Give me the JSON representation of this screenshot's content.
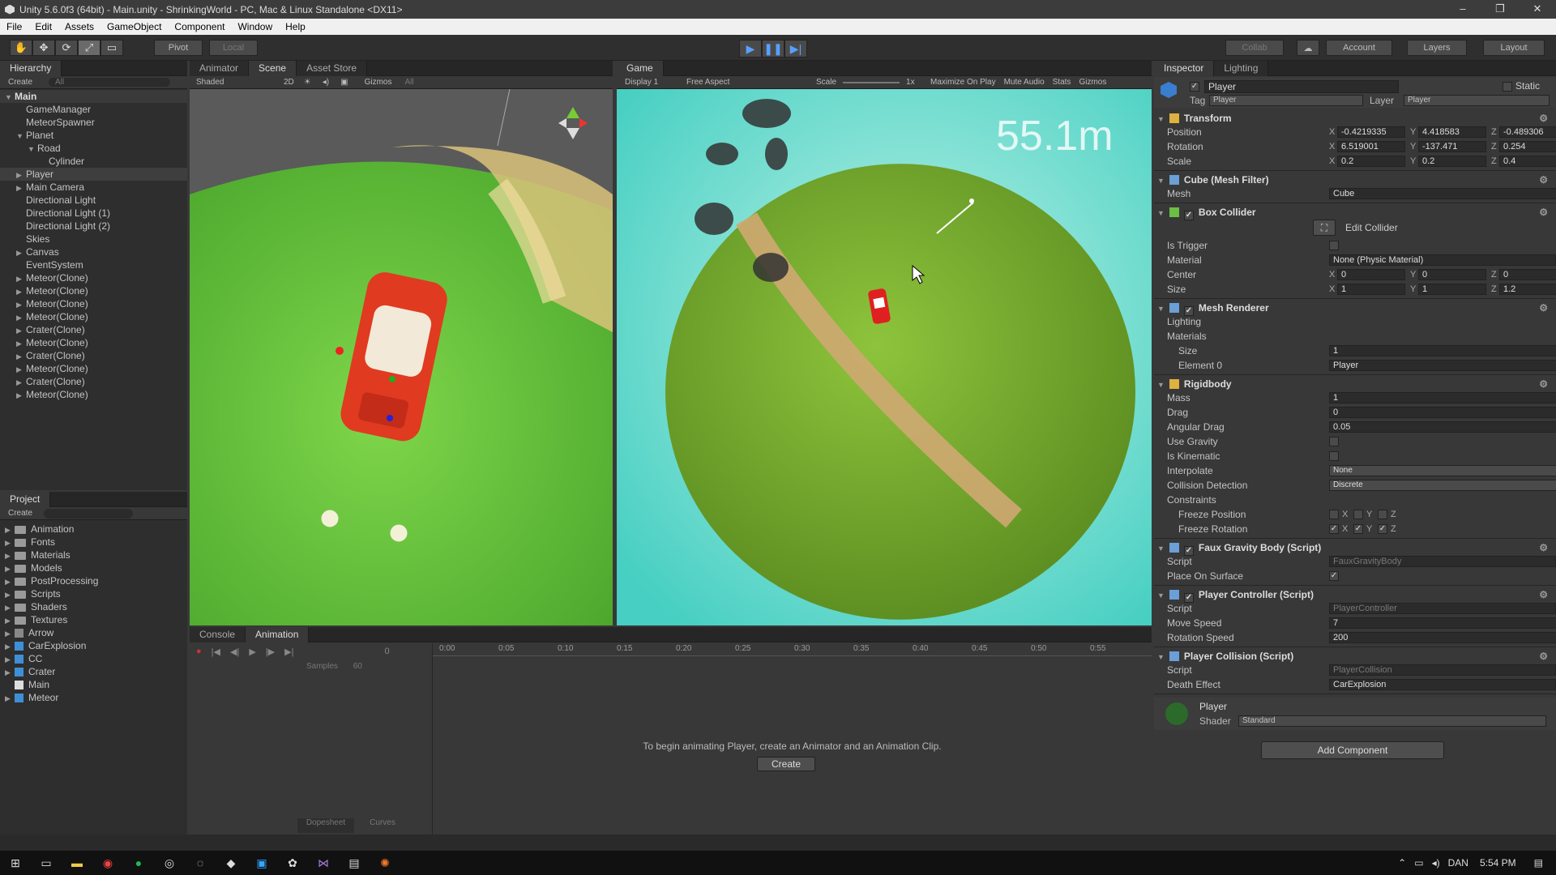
{
  "window": {
    "title": "Unity 5.6.0f3 (64bit) - Main.unity - ShrinkingWorld - PC, Mac & Linux Standalone <DX11>",
    "minimize": "–",
    "restore": "❐",
    "close": "✕"
  },
  "menu": [
    "File",
    "Edit",
    "Assets",
    "GameObject",
    "Component",
    "Window",
    "Help"
  ],
  "toolbar": {
    "pivot": "Pivot",
    "local": "Local",
    "collab": "Collab",
    "account": "Account",
    "layers": "Layers",
    "layout": "Layout",
    "tools": [
      "✋",
      "✥",
      "⟳",
      "⤢",
      "▭"
    ],
    "play": "▶",
    "pause": "❚❚",
    "step": "▶|"
  },
  "hierarchy": {
    "tab": "Hierarchy",
    "create": "Create",
    "search": "All",
    "scene": "Main",
    "items": [
      {
        "label": "GameManager",
        "indent": 1,
        "arrow": ""
      },
      {
        "label": "MeteorSpawner",
        "indent": 1,
        "arrow": ""
      },
      {
        "label": "Planet",
        "indent": 1,
        "arrow": "▼"
      },
      {
        "label": "Road",
        "indent": 2,
        "arrow": "▼"
      },
      {
        "label": "Cylinder",
        "indent": 3,
        "arrow": ""
      },
      {
        "label": "Player",
        "indent": 1,
        "arrow": "▶",
        "selected": true
      },
      {
        "label": "Main Camera",
        "indent": 1,
        "arrow": "▶"
      },
      {
        "label": "Directional Light",
        "indent": 1,
        "arrow": ""
      },
      {
        "label": "Directional Light (1)",
        "indent": 1,
        "arrow": ""
      },
      {
        "label": "Directional Light (2)",
        "indent": 1,
        "arrow": ""
      },
      {
        "label": "Skies",
        "indent": 1,
        "arrow": ""
      },
      {
        "label": "Canvas",
        "indent": 1,
        "arrow": "▶"
      },
      {
        "label": "EventSystem",
        "indent": 1,
        "arrow": ""
      },
      {
        "label": "Meteor(Clone)",
        "indent": 1,
        "arrow": "▶"
      },
      {
        "label": "Meteor(Clone)",
        "indent": 1,
        "arrow": "▶"
      },
      {
        "label": "Meteor(Clone)",
        "indent": 1,
        "arrow": "▶"
      },
      {
        "label": "Meteor(Clone)",
        "indent": 1,
        "arrow": "▶"
      },
      {
        "label": "Crater(Clone)",
        "indent": 1,
        "arrow": "▶"
      },
      {
        "label": "Meteor(Clone)",
        "indent": 1,
        "arrow": "▶"
      },
      {
        "label": "Crater(Clone)",
        "indent": 1,
        "arrow": "▶"
      },
      {
        "label": "Meteor(Clone)",
        "indent": 1,
        "arrow": "▶"
      },
      {
        "label": "Crater(Clone)",
        "indent": 1,
        "arrow": "▶"
      },
      {
        "label": "Meteor(Clone)",
        "indent": 1,
        "arrow": "▶"
      }
    ]
  },
  "project": {
    "tab": "Project",
    "create": "Create",
    "folders": [
      "Animation",
      "Fonts",
      "Materials",
      "Models",
      "PostProcessing",
      "Scripts",
      "Shaders",
      "Textures"
    ],
    "assets": [
      {
        "label": "Arrow",
        "type": "mesh"
      },
      {
        "label": "CarExplosion",
        "type": "prefab"
      },
      {
        "label": "CC",
        "type": "cube"
      },
      {
        "label": "Crater",
        "type": "prefab"
      },
      {
        "label": "Main",
        "type": "scene"
      },
      {
        "label": "Meteor",
        "type": "prefab"
      }
    ]
  },
  "scene": {
    "tabs": [
      "Animator",
      "Scene",
      "Asset Store"
    ],
    "shaded": "Shaded",
    "mode2d": "2D",
    "gizmos": "Gizmos",
    "search": "All"
  },
  "game": {
    "tab": "Game",
    "display": "Display 1",
    "aspect": "Free Aspect",
    "scale": "Scale",
    "scale_val": "1x",
    "maximize": "Maximize On Play",
    "mute": "Mute Audio",
    "stats": "Stats",
    "gizmos": "Gizmos",
    "distance": "55.1m"
  },
  "animation": {
    "tabs": [
      "Console",
      "Animation"
    ],
    "samples_label": "Samples",
    "samples": "60",
    "frame": "0",
    "ticks": [
      "0:00",
      "0:05",
      "0:10",
      "0:15",
      "0:20",
      "0:25",
      "0:30",
      "0:35",
      "0:40",
      "0:45",
      "0:50",
      "0:55"
    ],
    "message": "To begin animating Player, create an Animator and an Animation Clip.",
    "create": "Create",
    "dopesheet": "Dopesheet",
    "curves": "Curves"
  },
  "inspector": {
    "tabs": [
      "Inspector",
      "Lighting"
    ],
    "name": "Player",
    "static": "Static",
    "tag_label": "Tag",
    "tag": "Player",
    "layer_label": "Layer",
    "layer": "Player",
    "transform": {
      "title": "Transform",
      "position": {
        "label": "Position",
        "x": "-0.4219335",
        "y": "4.418583",
        "z": "-0.489306"
      },
      "rotation": {
        "label": "Rotation",
        "x": "6.519001",
        "y": "-137.471",
        "z": "0.254"
      },
      "scale": {
        "label": "Scale",
        "x": "0.2",
        "y": "0.2",
        "z": "0.4"
      }
    },
    "meshfilter": {
      "title": "Cube (Mesh Filter)",
      "mesh_label": "Mesh",
      "mesh": "Cube"
    },
    "boxcollider": {
      "title": "Box Collider",
      "edit": "Edit Collider",
      "trigger": "Is Trigger",
      "material_label": "Material",
      "material": "None (Physic Material)",
      "center_label": "Center",
      "center": {
        "x": "0",
        "y": "0",
        "z": "0"
      },
      "size_label": "Size",
      "size": {
        "x": "1",
        "y": "1",
        "z": "1.2"
      }
    },
    "meshrenderer": {
      "title": "Mesh Renderer",
      "lighting": "Lighting",
      "materials": "Materials",
      "size_label": "Size",
      "size": "1",
      "element_label": "Element 0",
      "element": "Player"
    },
    "rigidbody": {
      "title": "Rigidbody",
      "mass_label": "Mass",
      "mass": "1",
      "drag_label": "Drag",
      "drag": "0",
      "adrag_label": "Angular Drag",
      "adrag": "0.05",
      "gravity": "Use Gravity",
      "kinematic": "Is Kinematic",
      "interp_label": "Interpolate",
      "interp": "None",
      "coll_label": "Collision Detection",
      "coll": "Discrete",
      "constraints": "Constraints",
      "fpos": "Freeze Position",
      "frot": "Freeze Rotation",
      "x": "X",
      "y": "Y",
      "z": "Z"
    },
    "faux": {
      "title": "Faux Gravity Body (Script)",
      "script_label": "Script",
      "script": "FauxGravityBody",
      "place_label": "Place On Surface"
    },
    "pc": {
      "title": "Player Controller (Script)",
      "script_label": "Script",
      "script": "PlayerController",
      "move_label": "Move Speed",
      "move": "7",
      "rot_label": "Rotation Speed",
      "rot": "200"
    },
    "pcol": {
      "title": "Player Collision (Script)",
      "script_label": "Script",
      "script": "PlayerCollision",
      "death_label": "Death Effect",
      "death": "CarExplosion"
    },
    "material": {
      "name": "Player",
      "shader_label": "Shader",
      "shader": "Standard"
    },
    "add": "Add Component"
  },
  "taskbar": {
    "lang": "DAN",
    "time": "5:54 PM"
  }
}
